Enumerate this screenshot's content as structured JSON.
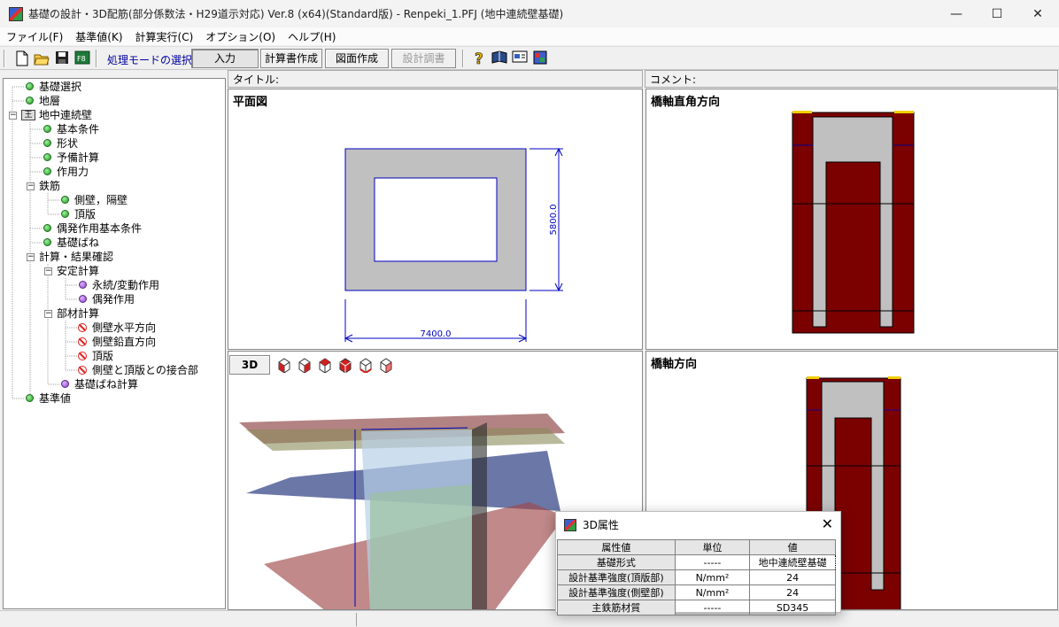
{
  "window": {
    "title": "基礎の設計・3D配筋(部分係数法・H29道示対応) Ver.8 (x64)(Standard版) - Renpeki_1.PFJ (地中連続壁基礎)",
    "minimize": "—",
    "maximize": "☐",
    "close": "✕"
  },
  "menu": [
    "ファイル(F)",
    "基準値(K)",
    "計算実行(C)",
    "オプション(O)",
    "ヘルプ(H)"
  ],
  "toolbar": {
    "mode_label": "処理モードの選択",
    "buttons": [
      "入力",
      "計算書作成",
      "図面作成",
      "設計調書"
    ],
    "icons": [
      "new-file-icon",
      "open-folder-icon",
      "save-icon",
      "export-icon",
      "help-icon",
      "book-icon",
      "card-icon",
      "app-icon"
    ]
  },
  "tree": [
    {
      "label": "基礎選択",
      "status": "green"
    },
    {
      "label": "地層",
      "status": "green"
    },
    {
      "label": "地中連続壁",
      "status": "root"
    },
    {
      "label": "基本条件",
      "status": "green"
    },
    {
      "label": "形状",
      "status": "green"
    },
    {
      "label": "予備計算",
      "status": "green"
    },
    {
      "label": "作用力",
      "status": "green"
    },
    {
      "label": "鉄筋",
      "status": "folder"
    },
    {
      "label": "側壁，隔壁",
      "status": "green"
    },
    {
      "label": "頂版",
      "status": "green"
    },
    {
      "label": "偶発作用基本条件",
      "status": "green"
    },
    {
      "label": "基礎ばね",
      "status": "green"
    },
    {
      "label": "計算・結果確認",
      "status": "folder"
    },
    {
      "label": "安定計算",
      "status": "folder"
    },
    {
      "label": "永続/変動作用",
      "status": "purple"
    },
    {
      "label": "偶発作用",
      "status": "purple"
    },
    {
      "label": "部材計算",
      "status": "folder"
    },
    {
      "label": "側壁水平方向",
      "status": "ban"
    },
    {
      "label": "側壁鉛直方向",
      "status": "ban"
    },
    {
      "label": "頂版",
      "status": "ban"
    },
    {
      "label": "側壁と頂版との接合部",
      "status": "ban"
    },
    {
      "label": "基礎ばね計算",
      "status": "purple"
    },
    {
      "label": "基準値",
      "status": "green"
    }
  ],
  "panels": {
    "title_label": "タイトル:",
    "comment_label": "コメント:",
    "plan_title": "平面図",
    "perp_title": "橋軸直角方向",
    "axis_title": "橋軸方向",
    "btn_3d": "3D",
    "dim_height": "5800.0",
    "dim_width": "7400.0"
  },
  "dialog": {
    "title": "3D属性",
    "close": "✕",
    "headers": [
      "属性値",
      "単位",
      "値"
    ],
    "rows": [
      [
        "基礎形式",
        "-----",
        "地中連続壁基礎"
      ],
      [
        "設計基準強度(頂版部)",
        "N/mm²",
        "24"
      ],
      [
        "設計基準強度(側壁部)",
        "N/mm²",
        "24"
      ],
      [
        "主鉄筋材質",
        "-----",
        "SD345"
      ]
    ]
  },
  "colors": {
    "concrete": "#c0c0c0",
    "rebar_section": "#7b0000",
    "dimension": "#0000c0",
    "tree_green": "#1e9a1e",
    "tree_purple": "#8a3cc9",
    "tree_ban": "#e02020"
  }
}
